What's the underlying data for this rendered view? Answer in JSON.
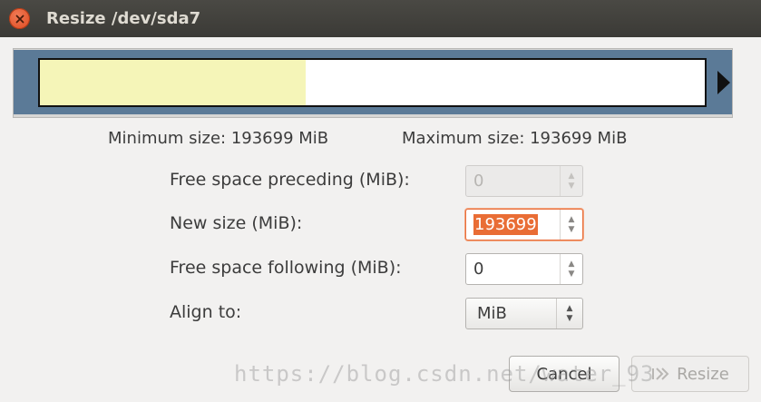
{
  "window": {
    "title": "Resize /dev/sda7"
  },
  "partition_bar": {
    "used_fraction": 0.4
  },
  "sizes": {
    "minimum": "Minimum size: 193699 MiB",
    "maximum": "Maximum size: 193699 MiB"
  },
  "fields": {
    "free_preceding": {
      "label": "Free space preceding (MiB):",
      "value": "0"
    },
    "new_size": {
      "label": "New size (MiB):",
      "value": "193699"
    },
    "free_following": {
      "label": "Free space following (MiB):",
      "value": "0"
    },
    "align": {
      "label": "Align to:",
      "value": "MiB"
    }
  },
  "buttons": {
    "cancel": "Cancel",
    "resize": "Resize"
  },
  "watermark": "https://blog.csdn.net/water_93",
  "colors": {
    "titlebar": "#3c3b37",
    "partition_border": "#5b7a97",
    "used_fill": "#f5f5b8",
    "focus": "#e96d35"
  }
}
